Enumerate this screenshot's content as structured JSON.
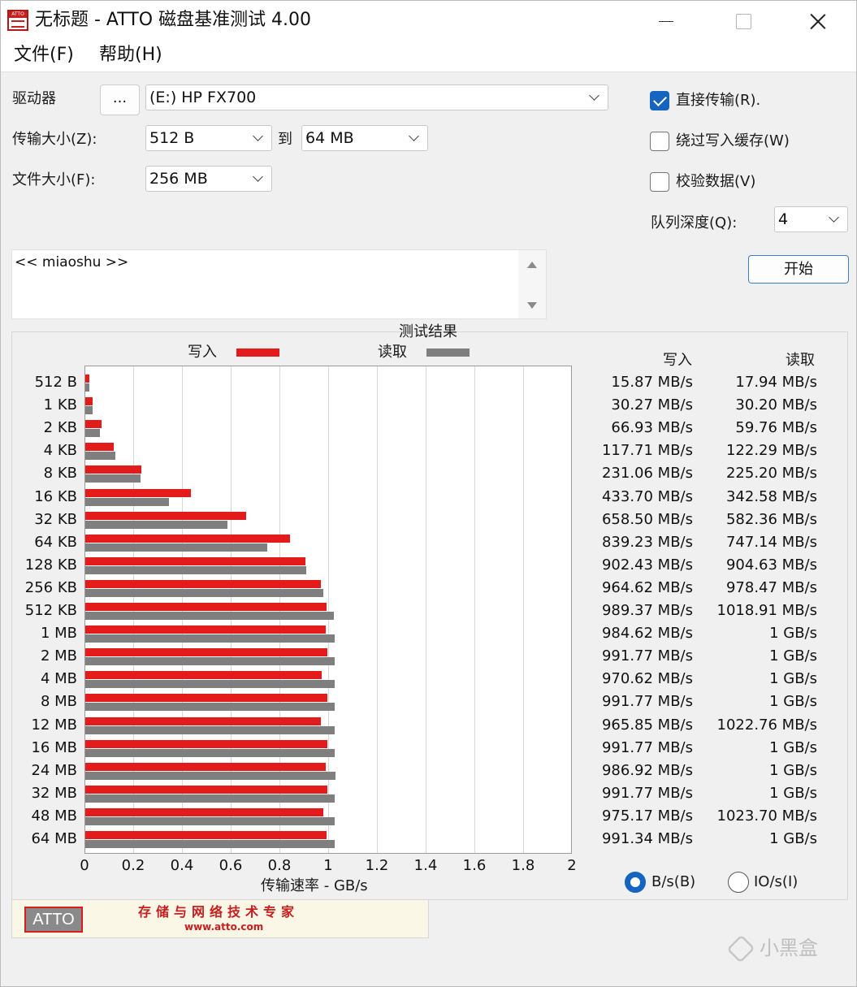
{
  "window": {
    "title": "无标题 - ATTO 磁盘基准测试 4.00",
    "icon_label": "ATTO"
  },
  "menu": [
    "文件(F)",
    "帮助(H)"
  ],
  "settings": {
    "drive_label": "驱动器",
    "browse_label": "...",
    "drive_value": "(E:) HP FX700",
    "transfer_size_label": "传输大小(Z):",
    "transfer_from": "512 B",
    "to_label": "到",
    "transfer_to": "64 MB",
    "file_size_label": "文件大小(F):",
    "file_size": "256 MB",
    "direct_io_label": "直接传输(R).",
    "direct_io_checked": true,
    "bypass_cache_label": "绕过写入缓存(W)",
    "bypass_cache_checked": false,
    "verify_label": "校验数据(V)",
    "verify_checked": false,
    "queue_depth_label": "队列深度(Q):",
    "queue_depth": "4",
    "start_label": "开始",
    "description": "<< miaoshu >>"
  },
  "results": {
    "title": "测试结果",
    "legend_write": "写入",
    "legend_read": "读取",
    "column_write": "写入",
    "column_read": "读取",
    "write_values": [
      "15.87 MB/s",
      "30.27 MB/s",
      "66.93 MB/s",
      "117.71 MB/s",
      "231.06 MB/s",
      "433.70 MB/s",
      "658.50 MB/s",
      "839.23 MB/s",
      "902.43 MB/s",
      "964.62 MB/s",
      "989.37 MB/s",
      "984.62 MB/s",
      "991.77 MB/s",
      "970.62 MB/s",
      "991.77 MB/s",
      "965.85 MB/s",
      "991.77 MB/s",
      "986.92 MB/s",
      "991.77 MB/s",
      "975.17 MB/s",
      "991.34 MB/s"
    ],
    "read_values": [
      "17.94 MB/s",
      "30.20 MB/s",
      "59.76 MB/s",
      "122.29 MB/s",
      "225.20 MB/s",
      "342.58 MB/s",
      "582.36 MB/s",
      "747.14 MB/s",
      "904.63 MB/s",
      "978.47 MB/s",
      "1018.91 MB/s",
      "1 GB/s",
      "1 GB/s",
      "1 GB/s",
      "1 GB/s",
      "1022.76 MB/s",
      "1 GB/s",
      "1 GB/s",
      "1 GB/s",
      "1023.70 MB/s",
      "1 GB/s"
    ],
    "units_bytes_label": "B/s(B)",
    "units_io_label": "IO/s(I)",
    "units_selected": "B/s"
  },
  "chart_data": {
    "type": "bar",
    "orientation": "horizontal",
    "title": "测试结果",
    "xlabel": "传输速率 - GB/s",
    "xlim": [
      0,
      2
    ],
    "xticks": [
      "0",
      "0.2",
      "0.4",
      "0.6",
      "0.8",
      "1",
      "1.2",
      "1.4",
      "1.6",
      "1.8",
      "2"
    ],
    "grid": true,
    "legend": "top",
    "categories": [
      "512 B",
      "1 KB",
      "2 KB",
      "4 KB",
      "8 KB",
      "16 KB",
      "32 KB",
      "64 KB",
      "128 KB",
      "256 KB",
      "512 KB",
      "1 MB",
      "2 MB",
      "4 MB",
      "8 MB",
      "12 MB",
      "16 MB",
      "24 MB",
      "32 MB",
      "48 MB",
      "64 MB"
    ],
    "series": [
      {
        "name": "写入",
        "color": "#e31b1b",
        "values": [
          0.016,
          0.03,
          0.067,
          0.118,
          0.231,
          0.434,
          0.659,
          0.839,
          0.902,
          0.965,
          0.989,
          0.985,
          0.992,
          0.971,
          0.992,
          0.966,
          0.992,
          0.987,
          0.992,
          0.975,
          0.991
        ]
      },
      {
        "name": "读取",
        "color": "#7f7f7f",
        "values": [
          0.018,
          0.03,
          0.06,
          0.122,
          0.225,
          0.343,
          0.582,
          0.747,
          0.905,
          0.978,
          1.019,
          1.023,
          1.023,
          1.023,
          1.023,
          1.023,
          1.023,
          1.028,
          1.023,
          1.024,
          1.023
        ]
      }
    ]
  },
  "banner": {
    "logo_text": "ATTO",
    "slogan": "存储与网络技术专家",
    "url": "www.atto.com"
  },
  "watermark": {
    "text": "小黑盒"
  }
}
